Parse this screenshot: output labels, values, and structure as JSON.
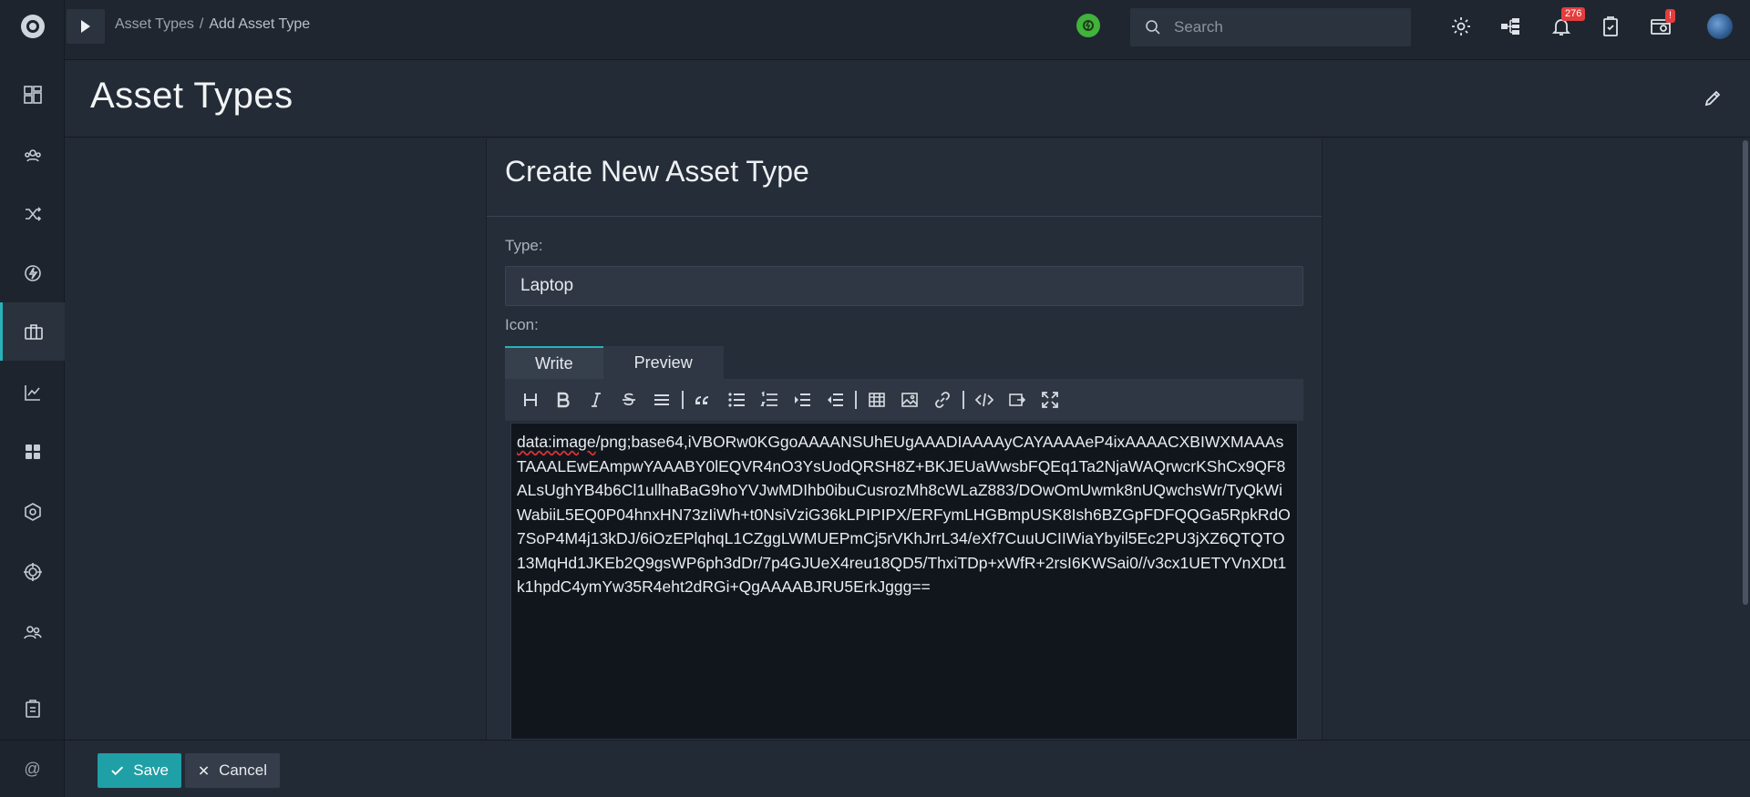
{
  "breadcrumb": {
    "parent": "Asset Types",
    "separator": "/",
    "current": "Add Asset Type"
  },
  "search": {
    "placeholder": "Search"
  },
  "notifications": {
    "count": "276"
  },
  "alert_badge": "!",
  "page": {
    "title": "Asset Types"
  },
  "form": {
    "title": "Create New Asset Type",
    "type_label": "Type:",
    "type_value": "Laptop",
    "icon_label": "Icon:",
    "tabs": [
      {
        "label": "Write"
      },
      {
        "label": "Preview"
      }
    ],
    "icon_text_prefix": "data:image",
    "icon_text_rest": "/png;base64,iVBORw0KGgoAAAANSUhEUgAAADIAAAAyCAYAAAAeP4ixAAAACXBIWXMAAAsTAAALEwEAmpwYAAABY0lEQVR4nO3YsUodQRSH8Z+BKJEUaWwsbFQEq1Ta2NjaWAQrwcrKShCx9QF8ALsUghYB4b6Cl1ullhaBaG9hoYVJwMDIhb0ibuCusrozMh8cWLaZ883/DOwOmUwmk8nUQwchsWr/TyQkWiWabiiL5EQ0P04hnxHN73zIiWh+t0NsiVziG36kLPIPIPX/ERFymLHGBmpUSK8Ish6BZGpFDFQQGa5RpkRdO7SoP4M4j13kDJ/6iOzEPlqhqL1CZggLWMUEPmCj5rVKhJrrL34/eXf7CuuUCIIWiaYbyil5Ec2PU3jXZ6QTQTO13MqHd1JKEb2Q9gsWP6ph3dDr/7p4GJUeX4reu18QD5/ThxiTDp+xWfR+2rsI6KWSai0//v3cx1UETYVnXDt1k1hpdC4ymYw35R4eht2dRGi+QgAAAABJRU5ErkJggg=="
  },
  "buttons": {
    "save": "Save",
    "cancel": "Cancel"
  },
  "sidebar_bottom": "@",
  "colors": {
    "accent": "#26b3b9",
    "save": "#1f9fa6",
    "badge": "#e43d3d",
    "status": "#41b23b"
  }
}
